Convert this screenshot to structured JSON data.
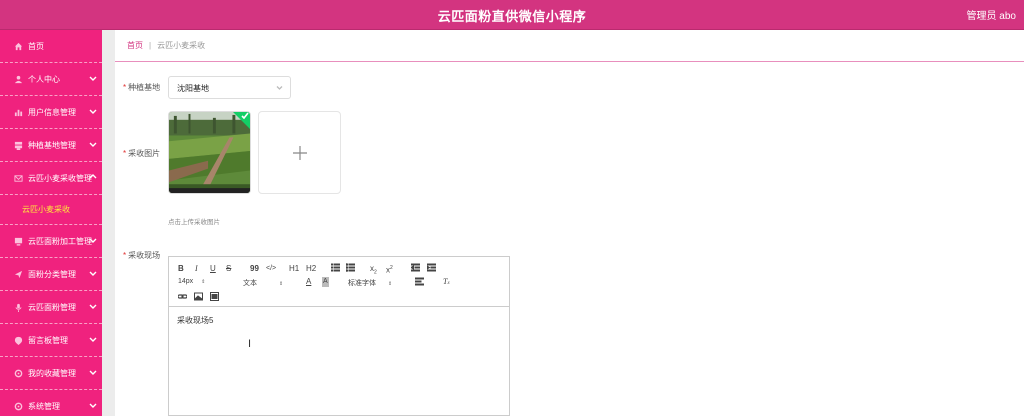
{
  "header": {
    "title": "云匹面粉直供微信小程序",
    "user": "管理员 abo"
  },
  "sidebar": {
    "items": [
      {
        "label": "首页",
        "icon": "home-icon",
        "chevron": false
      },
      {
        "label": "个人中心",
        "icon": "user-icon",
        "chevron": true
      },
      {
        "label": "用户信息管理",
        "icon": "chart-icon",
        "chevron": true
      },
      {
        "label": "种植基地管理",
        "icon": "database-icon",
        "chevron": true
      },
      {
        "label": "云匹小麦采收管理",
        "icon": "mail-icon",
        "chevron": true,
        "expanded": true
      },
      {
        "label": "云匹面粉加工管理",
        "icon": "monitor-icon",
        "chevron": true
      },
      {
        "label": "面粉分类管理",
        "icon": "send-icon",
        "chevron": true
      },
      {
        "label": "云匹面粉管理",
        "icon": "mic-icon",
        "chevron": true
      },
      {
        "label": "留言板管理",
        "icon": "location-icon",
        "chevron": true
      },
      {
        "label": "我的收藏管理",
        "icon": "settings-icon",
        "chevron": true
      },
      {
        "label": "系统管理",
        "icon": "settings-icon",
        "chevron": true
      }
    ],
    "sub_item": "云匹小麦采收"
  },
  "breadcrumb": {
    "home": "首页",
    "separator": "|",
    "current": "云匹小麦采收"
  },
  "form": {
    "base_label": "种植基地",
    "base_value": "沈阳基地",
    "image_label": "采收图片",
    "upload_tip": "点击上传采收图片",
    "scene_label": "采收现场",
    "required_mark": "*"
  },
  "editor": {
    "font_size": "14px",
    "text_type": "文本",
    "font_family": "标准字体",
    "content": "采收现场5",
    "buttons": [
      "B",
      "I",
      "U",
      "S",
      "99",
      "</>",
      "H1",
      "H2",
      "ol",
      "ul",
      "x2sub",
      "x2sup",
      "outdent",
      "indent"
    ]
  },
  "colors": {
    "header": "#d33480",
    "sidebar": "#f0227e",
    "active_sub": "#ffea3b",
    "accent": "#d33480"
  }
}
